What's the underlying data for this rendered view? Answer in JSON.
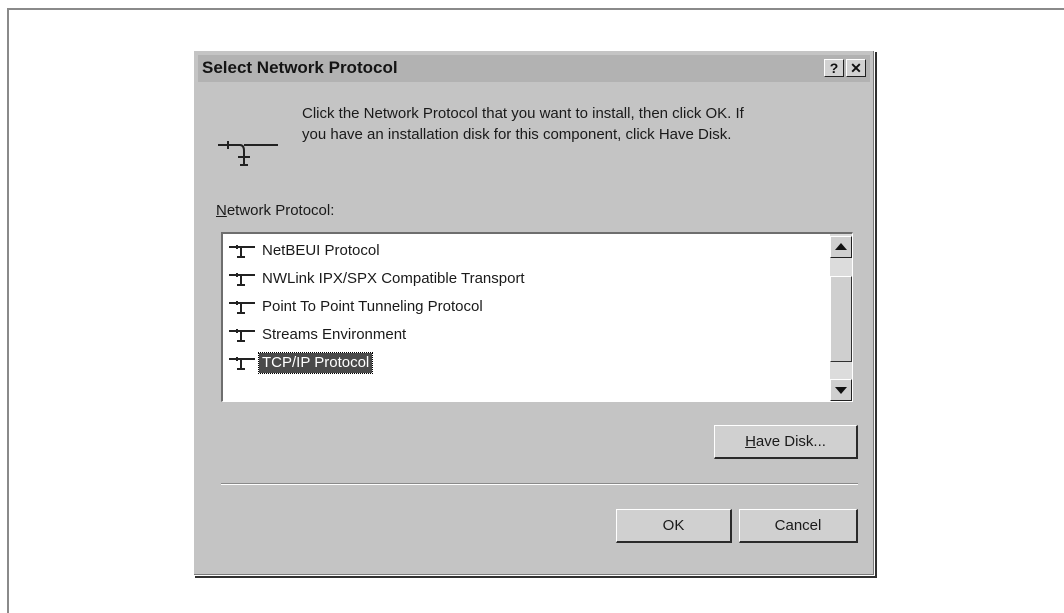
{
  "dialog": {
    "title": "Select Network Protocol",
    "help_button": "?",
    "close_button": "✕",
    "intro_line1": "Click the Network Protocol that you want to install, then click OK.  If",
    "intro_line2": "you have an installation disk for this component, click Have Disk.",
    "list_label_accel": "N",
    "list_label_rest": "etwork Protocol:",
    "protocols": [
      {
        "label": "NetBEUI Protocol",
        "selected": false
      },
      {
        "label": "NWLink IPX/SPX Compatible Transport",
        "selected": false
      },
      {
        "label": "Point To Point Tunneling Protocol",
        "selected": false
      },
      {
        "label": "Streams Environment",
        "selected": false
      },
      {
        "label": "TCP/IP Protocol",
        "selected": true
      }
    ],
    "have_disk_accel": "H",
    "have_disk_rest": "ave Disk...",
    "ok_label": "OK",
    "cancel_label": "Cancel"
  },
  "icons": {
    "protocol": "network-cable-icon",
    "scroll_up": "up-arrow-icon",
    "scroll_down": "down-arrow-icon"
  },
  "colors": {
    "dialog_face": "#c4c4c4",
    "titlebar": "#b2b2b2",
    "selection": "#4a4a4a"
  }
}
